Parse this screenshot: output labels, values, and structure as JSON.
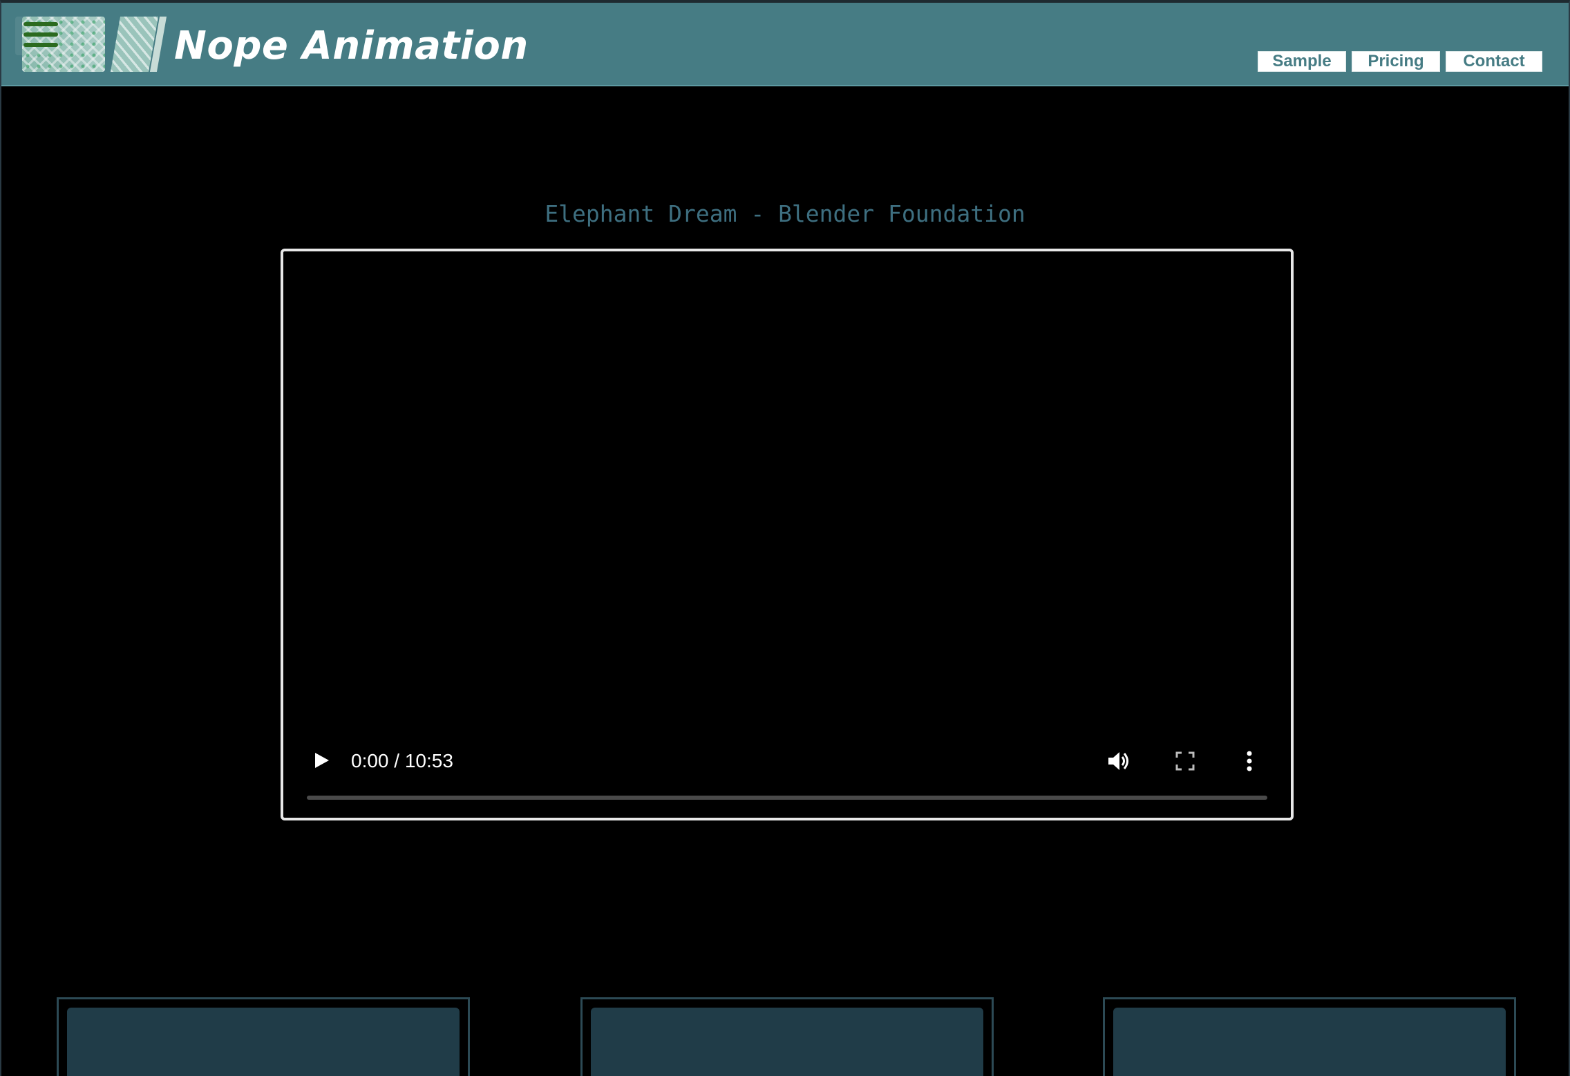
{
  "header": {
    "brand": "Nope Animation",
    "nav": [
      {
        "label": "Sample"
      },
      {
        "label": "Pricing"
      },
      {
        "label": "Contact"
      }
    ],
    "colors": {
      "background": "#467c84",
      "brand_text": "#ffffff",
      "nav_text": "#467c84",
      "hamburger": "#2b6a1f"
    }
  },
  "video": {
    "title": "Elephant Dream - Blender Foundation",
    "time_display": "0:00 / 10:53",
    "progress": 0,
    "icons": [
      "play-icon",
      "volume-icon",
      "fullscreen-icon",
      "more-options-icon"
    ]
  },
  "cards": [
    {
      "id": 1
    },
    {
      "id": 2
    },
    {
      "id": 3
    }
  ]
}
